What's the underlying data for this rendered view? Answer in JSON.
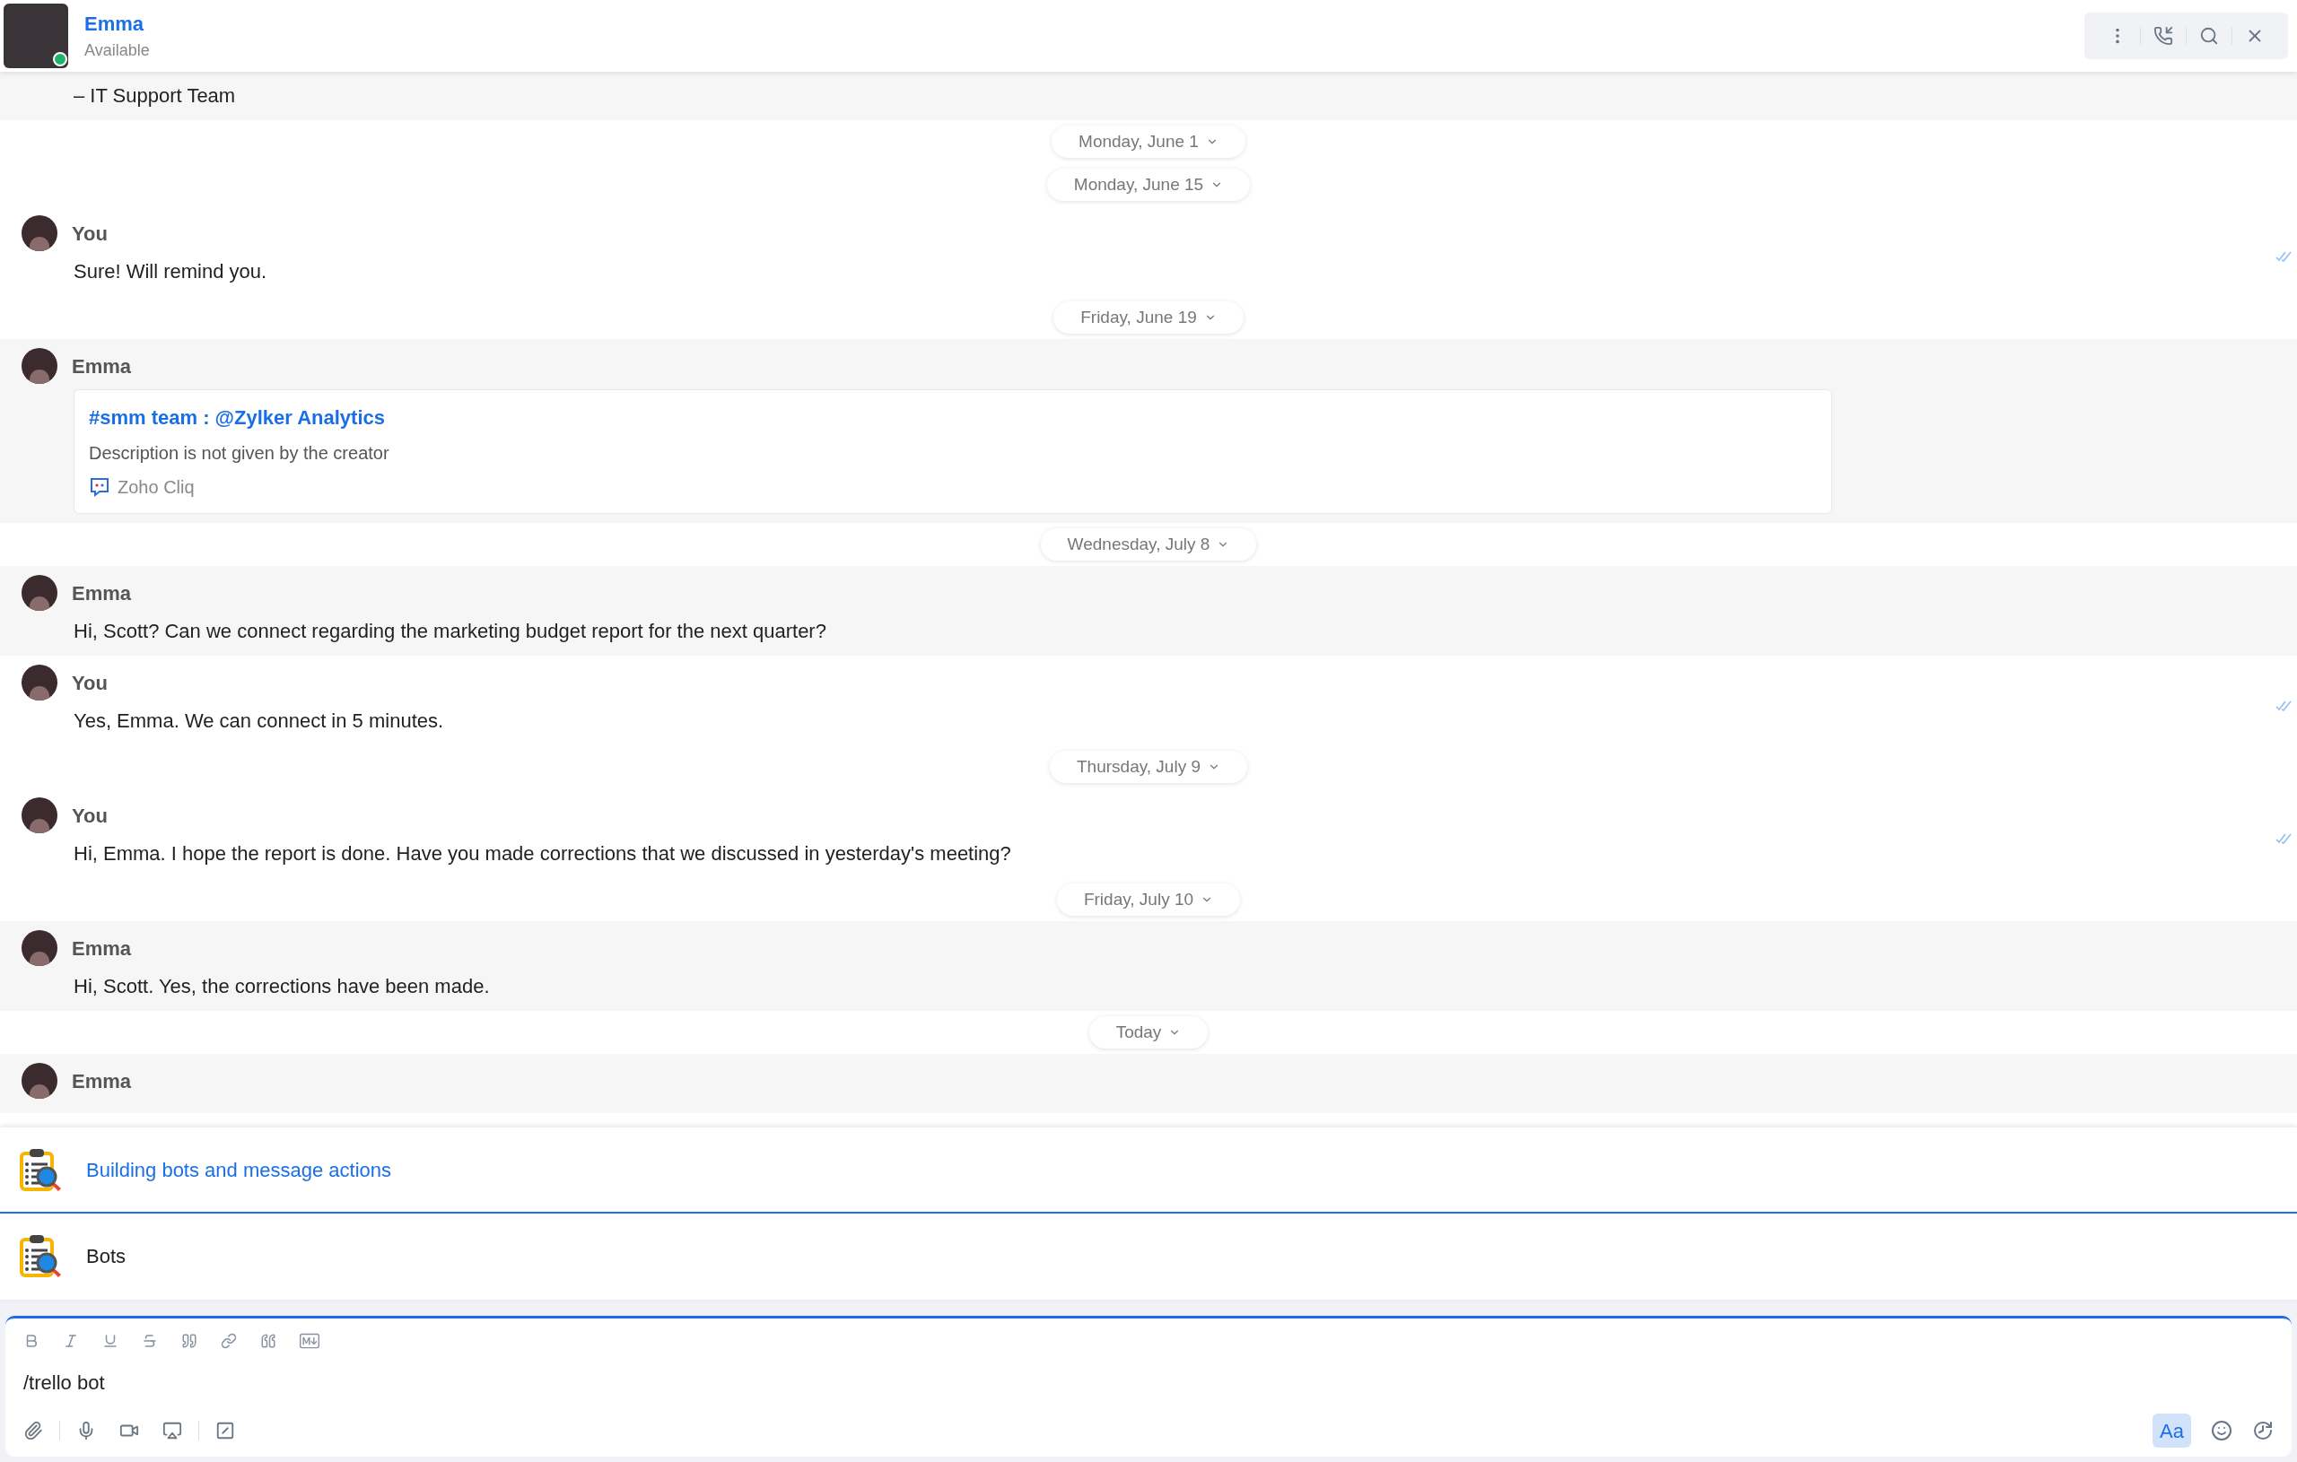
{
  "header": {
    "name": "Emma",
    "status": "Available",
    "online": true
  },
  "stream": [
    {
      "kind": "received",
      "lines": [
        "– IT Support Team"
      ],
      "read": false
    },
    {
      "kind": "date",
      "label": "Monday, June 1"
    },
    {
      "kind": "date",
      "label": "Monday, June 15"
    },
    {
      "kind": "sent",
      "sender": "You",
      "lines": [
        "Sure! Will remind you."
      ],
      "read": true
    },
    {
      "kind": "date",
      "label": "Friday, June 19"
    },
    {
      "kind": "card",
      "sender": "Emma",
      "title": "#smm team : @Zylker Analytics",
      "description": "Description is not given by the creator",
      "source": "Zoho Cliq"
    },
    {
      "kind": "date",
      "label": "Wednesday, July 8"
    },
    {
      "kind": "received",
      "sender": "Emma",
      "lines": [
        "Hi, Scott? Can we connect regarding the marketing budget report for the next quarter?"
      ],
      "read": false
    },
    {
      "kind": "sent",
      "sender": "You",
      "lines": [
        "Yes, Emma. We can connect in 5 minutes."
      ],
      "read": true
    },
    {
      "kind": "date",
      "label": "Thursday, July 9"
    },
    {
      "kind": "sent",
      "sender": "You",
      "lines": [
        "Hi, Emma. I hope the report is done. Have you made corrections that we discussed in yesterday's meeting?"
      ],
      "read": true
    },
    {
      "kind": "date",
      "label": "Friday, July 10"
    },
    {
      "kind": "received",
      "sender": "Emma",
      "lines": [
        "Hi, Scott. Yes, the corrections have been made."
      ],
      "read": false
    },
    {
      "kind": "date",
      "label": "Today"
    },
    {
      "kind": "received",
      "sender": "Emma",
      "read": false
    }
  ],
  "suggestions": [
    {
      "label": "Building bots and message actions",
      "selected": true
    },
    {
      "label": "Bots",
      "selected": false
    }
  ],
  "composer": {
    "value": "/trello bot",
    "format_button": {
      "label": "Aa",
      "on": true
    }
  }
}
